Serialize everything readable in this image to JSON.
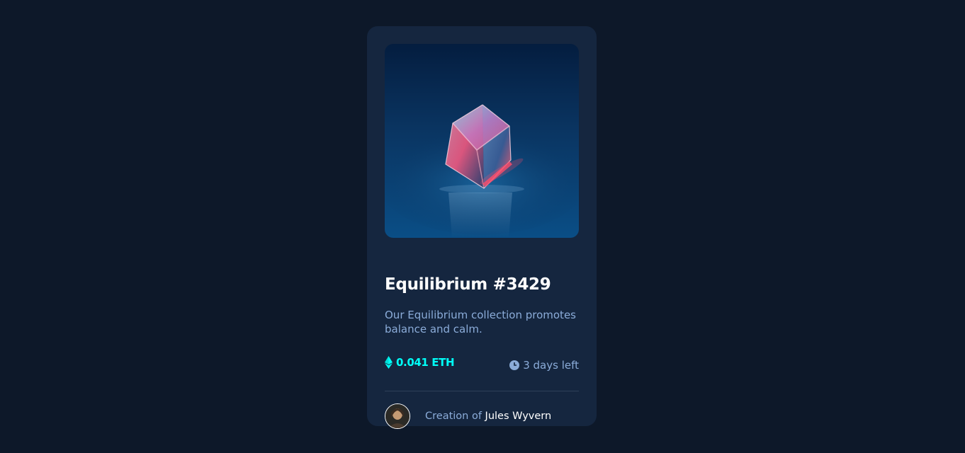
{
  "card": {
    "title": "Equilibrium #3429",
    "description": "Our Equilibrium collection promotes balance and calm.",
    "price": "0.041 ETH",
    "time_left": "3 days left",
    "creator_prefix": "Creation of",
    "creator_name": "Jules Wyvern"
  },
  "icons": {
    "price_icon": "ethereum-icon",
    "time_icon": "clock-icon"
  },
  "colors": {
    "background": "#0d1829",
    "card": "#15263f",
    "accent": "#00fff8",
    "muted_text": "#8bacd9",
    "divider": "#2e405a",
    "white": "#ffffff"
  }
}
